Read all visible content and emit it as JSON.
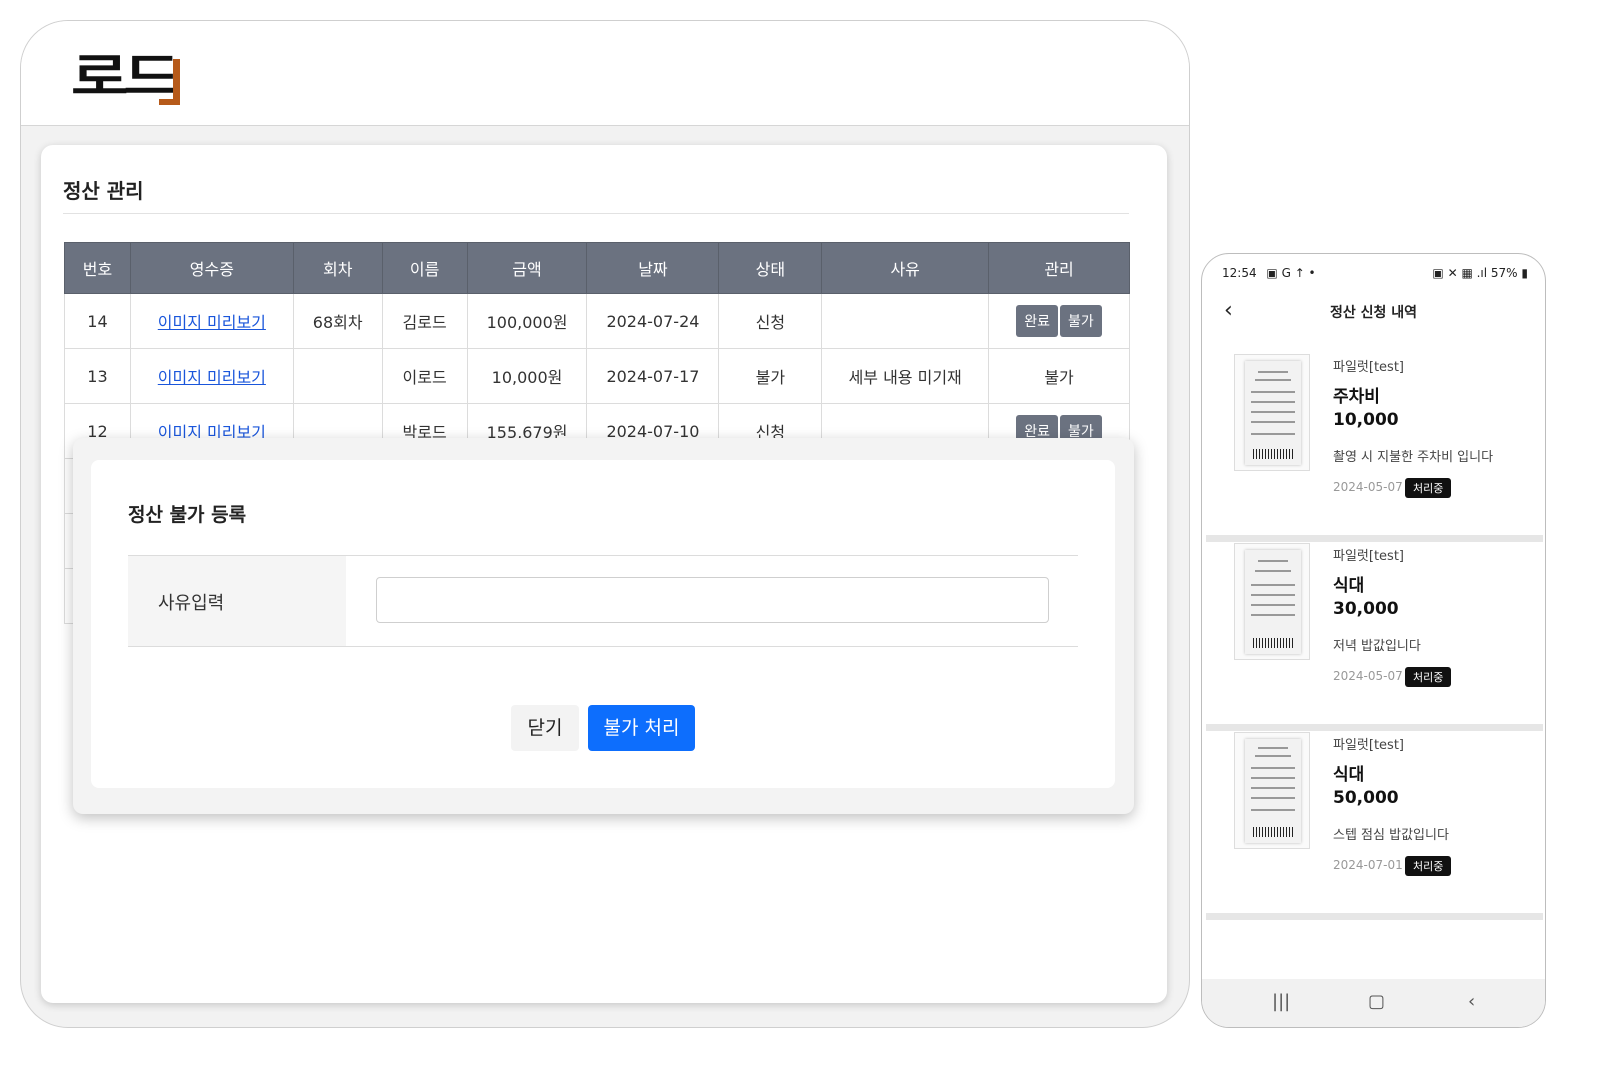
{
  "desktop": {
    "logo_text": "로드",
    "page_title": "정산 관리",
    "table": {
      "headers": [
        "번호",
        "영수증",
        "회차",
        "이름",
        "금액",
        "날짜",
        "상태",
        "사유",
        "관리"
      ],
      "rows": [
        {
          "no": "14",
          "receipt": "이미지 미리보기",
          "round": "68회차",
          "name": "김로드",
          "amount": "100,000원",
          "date": "2024-07-24",
          "status": "신청",
          "reason": "",
          "action": "buttons"
        },
        {
          "no": "13",
          "receipt": "이미지 미리보기",
          "round": "",
          "name": "이로드",
          "amount": "10,000원",
          "date": "2024-07-17",
          "status": "불가",
          "reason": "세부 내용 미기재",
          "action": "불가"
        },
        {
          "no": "12",
          "receipt": "이미지 미리보기",
          "round": "",
          "name": "박로드",
          "amount": "155,679원",
          "date": "2024-07-10",
          "status": "신청",
          "reason": "",
          "action": "buttons"
        }
      ],
      "btn_complete": "완료",
      "btn_reject": "불가"
    },
    "modal": {
      "title": "정산 불가 등록",
      "field_label": "사유입력",
      "field_value": "",
      "close_label": "닫기",
      "submit_label": "불가 처리"
    }
  },
  "phone": {
    "status_time": "12:54",
    "status_right": "57%",
    "title": "정산 신청 내역",
    "items": [
      {
        "who": "파일럿[test]",
        "category": "주차비",
        "amount": "10,000",
        "desc": "촬영 시 지불한 주차비 입니다",
        "date": "2024-05-07",
        "badge": "처리중"
      },
      {
        "who": "파일럿[test]",
        "category": "식대",
        "amount": "30,000",
        "desc": "저녁 밥값입니다",
        "date": "2024-05-07",
        "badge": "처리중"
      },
      {
        "who": "파일럿[test]",
        "category": "식대",
        "amount": "50,000",
        "desc": "스텝 점심 밥값입니다",
        "date": "2024-07-01",
        "badge": "처리중"
      }
    ],
    "softkeys": [
      "recent-apps-icon",
      "home-icon",
      "back-icon"
    ]
  }
}
